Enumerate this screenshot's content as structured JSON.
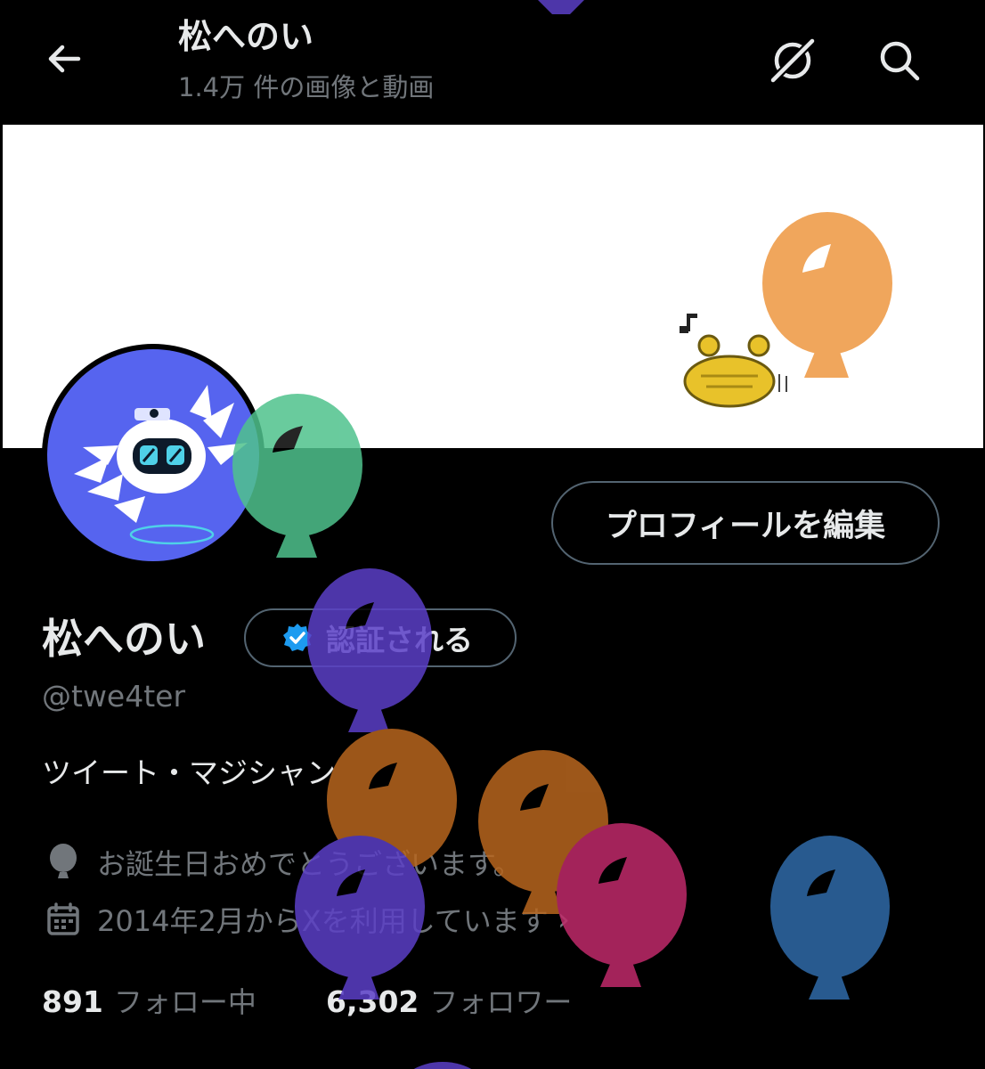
{
  "header": {
    "title": "松へのい",
    "subtitle": "1.4万 件の画像と動画",
    "back_icon": "arrow-left-icon",
    "icons": [
      "grok-icon",
      "search-icon"
    ]
  },
  "profile": {
    "edit_label": "プロフィールを編集",
    "display_name": "松へのい",
    "verified_label": "認証される",
    "handle": "@twe4ter",
    "bio": "ツイート・マジシャン",
    "location": "お誕生日おめでとうございます。",
    "joined": "2014年2月からXを利用しています",
    "joined_chevron": "›",
    "following_count": "891",
    "following_label": "フォロー中",
    "followers_count": "6,302",
    "followers_label": "フォロワー"
  },
  "colors": {
    "background": "#000000",
    "text_primary": "#e7e9ea",
    "text_secondary": "#71767b",
    "border": "#536471",
    "verified_blue": "#1d9bf0",
    "avatar_bg": "#5664ef",
    "banner_bg": "#ffffff"
  },
  "decorations": {
    "banner_balloon_color": "#f0a65c",
    "balloon_colors": [
      "#5b3fc7",
      "#4fc28d",
      "#b8661e",
      "#b8661e",
      "#5b3fc7",
      "#c02a6a",
      "#2f6aa8"
    ]
  }
}
